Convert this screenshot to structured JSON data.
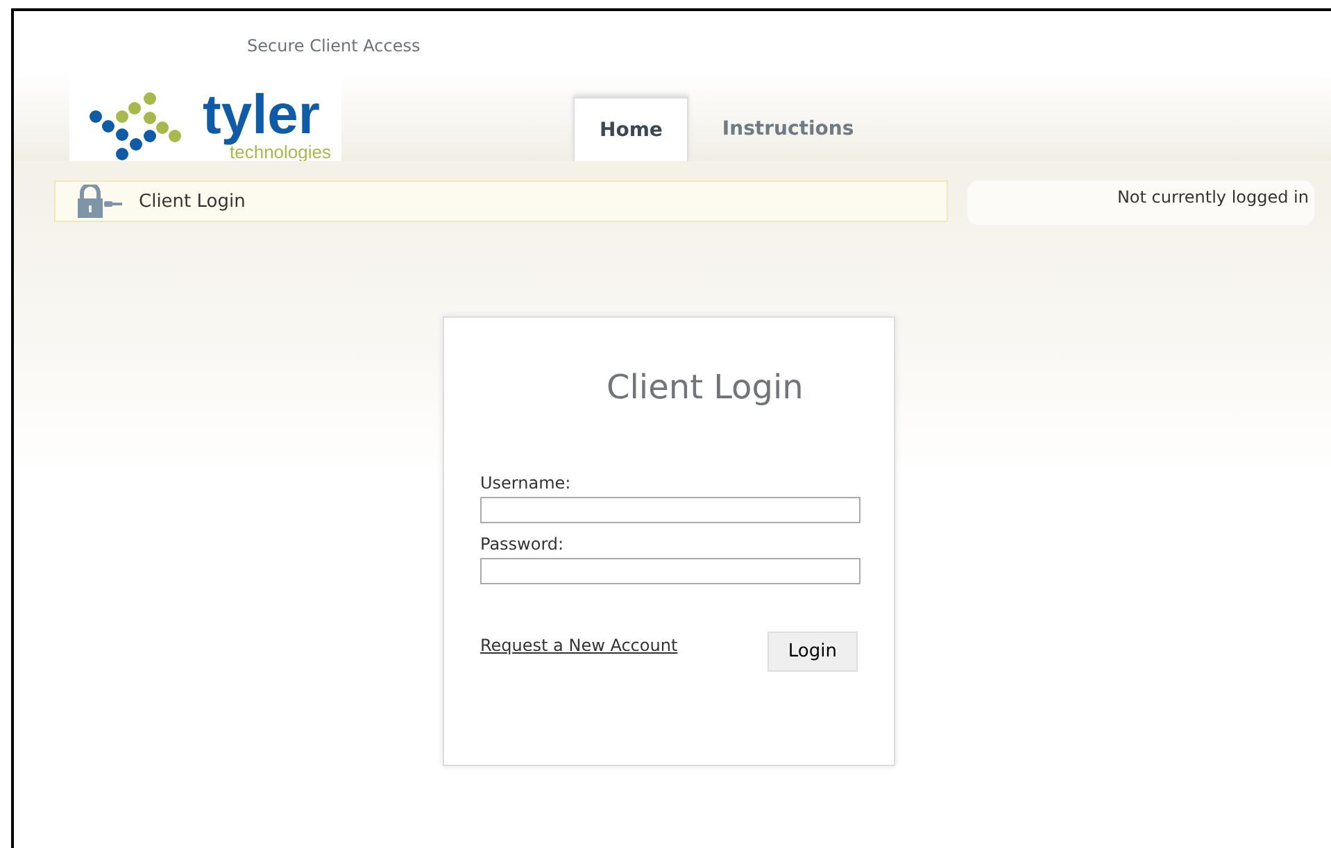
{
  "header": {
    "title": "Secure Client Access",
    "logo": {
      "name": "tyler",
      "tagline": "technologies"
    }
  },
  "tabs": [
    {
      "label": "Home",
      "selected": true
    },
    {
      "label": "Instructions",
      "selected": false
    }
  ],
  "breadcrumb": {
    "label": "Client Login"
  },
  "status": "Not currently logged in",
  "login": {
    "title": "Client Login",
    "fields": [
      {
        "label": "Username:"
      },
      {
        "label": "Password:"
      }
    ],
    "link": "Request a New Account",
    "button": "Login"
  }
}
